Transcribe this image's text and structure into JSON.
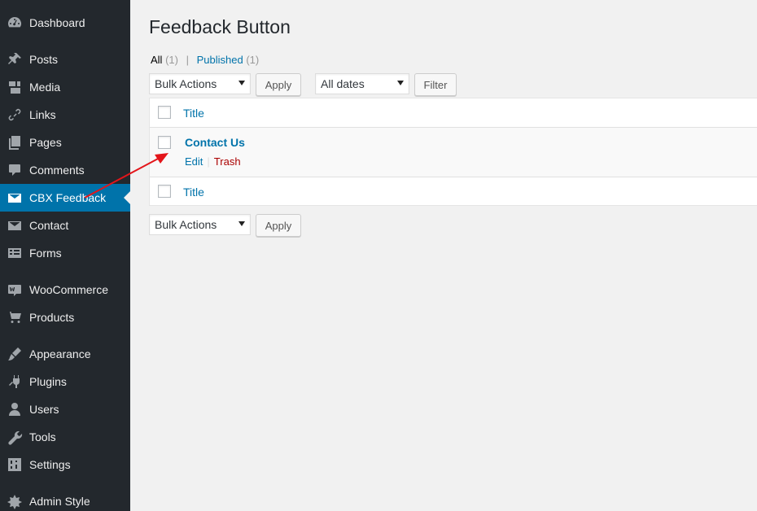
{
  "sidebar": {
    "items": [
      {
        "label": "Dashboard",
        "icon": "dashboard-icon"
      },
      {
        "label": "Posts",
        "icon": "pin-icon"
      },
      {
        "label": "Media",
        "icon": "media-icon"
      },
      {
        "label": "Links",
        "icon": "link-icon"
      },
      {
        "label": "Pages",
        "icon": "pages-icon"
      },
      {
        "label": "Comments",
        "icon": "comment-icon"
      },
      {
        "label": "CBX Feedback",
        "icon": "envelope-icon"
      },
      {
        "label": "Contact",
        "icon": "envelope-icon"
      },
      {
        "label": "Forms",
        "icon": "forms-icon"
      },
      {
        "label": "WooCommerce",
        "icon": "woo-icon"
      },
      {
        "label": "Products",
        "icon": "cart-icon"
      },
      {
        "label": "Appearance",
        "icon": "brush-icon"
      },
      {
        "label": "Plugins",
        "icon": "plugin-icon"
      },
      {
        "label": "Users",
        "icon": "user-icon"
      },
      {
        "label": "Tools",
        "icon": "wrench-icon"
      },
      {
        "label": "Settings",
        "icon": "settings-icon"
      },
      {
        "label": "Admin Style",
        "icon": "admin-style-icon"
      }
    ],
    "active": "CBX Feedback"
  },
  "page": {
    "title": "Feedback Button",
    "filters": {
      "all_label": "All",
      "all_count": "(1)",
      "separator": "|",
      "published_label": "Published",
      "published_count": "(1)"
    },
    "top_bulk_select": "Bulk Actions",
    "top_apply": "Apply",
    "dates_select": "All dates",
    "filter_button": "Filter",
    "bottom_bulk_select": "Bulk Actions",
    "bottom_apply": "Apply"
  },
  "table": {
    "header_title": "Title",
    "footer_title": "Title",
    "rows": [
      {
        "title": "Contact Us",
        "edit": "Edit",
        "separator": "|",
        "trash": "Trash"
      }
    ]
  },
  "colors": {
    "sidebar_bg": "#23282d",
    "active_menu": "#0073aa",
    "link": "#0073aa",
    "trash": "#a00000",
    "annotation_arrow": "#e3151a"
  }
}
